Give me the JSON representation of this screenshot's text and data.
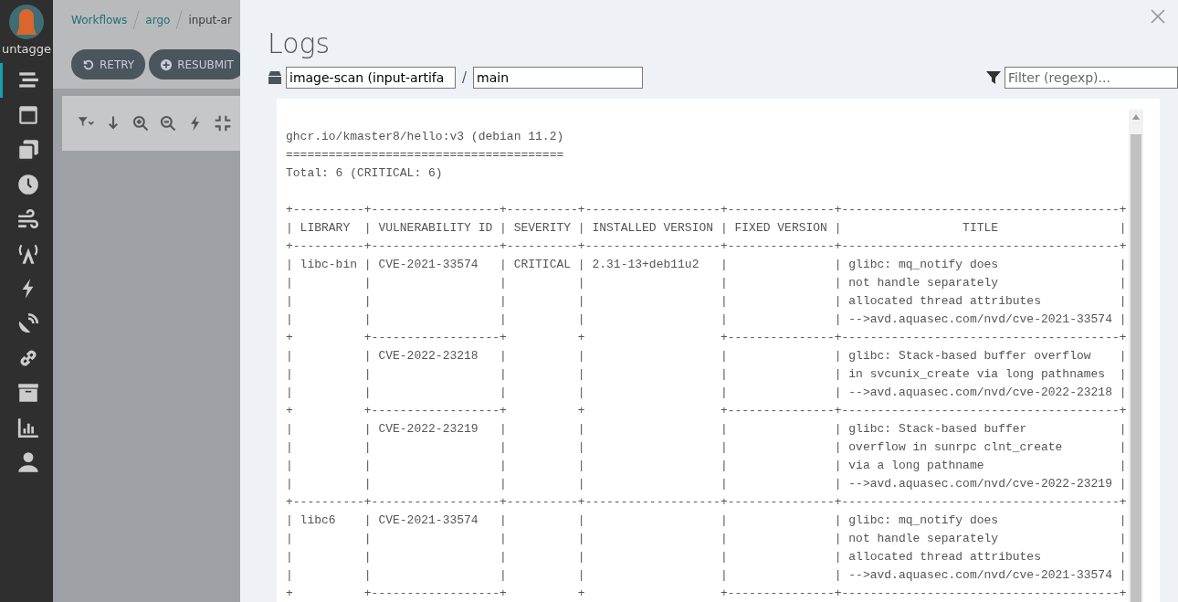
{
  "sidebar": {
    "user_label": "untagge",
    "items": [
      {
        "kind": "list",
        "selected": true
      },
      {
        "kind": "window",
        "selected": false
      },
      {
        "kind": "copies",
        "selected": false
      },
      {
        "kind": "clock",
        "selected": false
      },
      {
        "kind": "wind",
        "selected": false
      },
      {
        "kind": "antenna",
        "selected": false
      },
      {
        "kind": "bolt",
        "selected": false
      },
      {
        "kind": "dish",
        "selected": false
      },
      {
        "kind": "link",
        "selected": false
      },
      {
        "kind": "archive",
        "selected": false
      },
      {
        "kind": "chart",
        "selected": false
      },
      {
        "kind": "user",
        "selected": false
      }
    ]
  },
  "breadcrumbs": [
    "Workflows",
    "argo",
    "input-ar"
  ],
  "actions": [
    {
      "kind": "retry",
      "label": "RETRY"
    },
    {
      "kind": "resubmit",
      "label": "RESUBMIT"
    }
  ],
  "toolbar": [
    {
      "kind": "filter"
    },
    {
      "kind": "down"
    },
    {
      "kind": "zoom-in"
    },
    {
      "kind": "zoom-out"
    },
    {
      "kind": "bolt"
    },
    {
      "kind": "collapse"
    }
  ],
  "logs": {
    "title": "Logs",
    "node_value": "image-scan (input-artifa",
    "separator": "/",
    "container_value": "main",
    "filter_placeholder": "Filter (regexp)...",
    "header_lines": [
      "ghcr.io/kmaster8/hello:v3 (debian 11.2)",
      "=======================================",
      "Total: 6 (CRITICAL: 6)"
    ],
    "table_lines": [
      "+----------+------------------+----------+-------------------+---------------+---------------------------------------+",
      "| LIBRARY  | VULNERABILITY ID | SEVERITY | INSTALLED VERSION | FIXED VERSION |                 TITLE                 |",
      "+----------+------------------+----------+-------------------+---------------+---------------------------------------+",
      "| libc-bin | CVE-2021-33574   | CRITICAL | 2.31-13+deb11u2   |               | glibc: mq_notify does                 |",
      "|          |                  |          |                   |               | not handle separately                 |",
      "|          |                  |          |                   |               | allocated thread attributes           |",
      "|          |                  |          |                   |               | -->avd.aquasec.com/nvd/cve-2021-33574 |",
      "+          +------------------+          +                   +---------------+---------------------------------------+",
      "|          | CVE-2022-23218   |          |                   |               | glibc: Stack-based buffer overflow    |",
      "|          |                  |          |                   |               | in svcunix_create via long pathnames  |",
      "|          |                  |          |                   |               | -->avd.aquasec.com/nvd/cve-2022-23218 |",
      "+          +------------------+          +                   +---------------+---------------------------------------+",
      "|          | CVE-2022-23219   |          |                   |               | glibc: Stack-based buffer             |",
      "|          |                  |          |                   |               | overflow in sunrpc clnt_create        |",
      "|          |                  |          |                   |               | via a long pathname                   |",
      "|          |                  |          |                   |               | -->avd.aquasec.com/nvd/cve-2022-23219 |",
      "+----------+------------------+----------+-------------------+---------------+---------------------------------------+",
      "| libc6    | CVE-2021-33574   |          |                   |               | glibc: mq_notify does                 |",
      "|          |                  |          |                   |               | not handle separately                 |",
      "|          |                  |          |                   |               | allocated thread attributes           |",
      "|          |                  |          |                   |               | -->avd.aquasec.com/nvd/cve-2021-33574 |",
      "+          +------------------+          +                   +---------------+---------------------------------------+"
    ]
  }
}
